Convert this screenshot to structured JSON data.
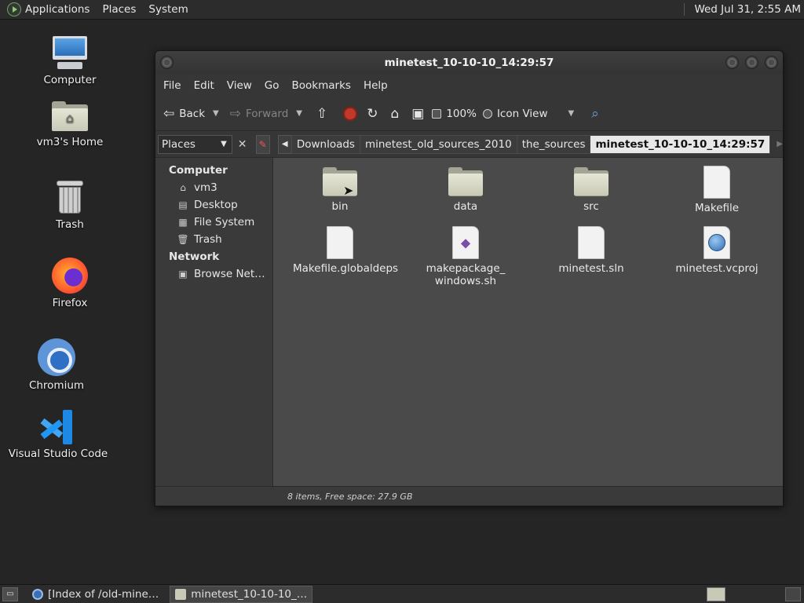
{
  "top_panel": {
    "menus": [
      "Applications",
      "Places",
      "System"
    ],
    "clock": "Wed Jul 31,  2:55 AM"
  },
  "desktop": {
    "icons": [
      {
        "label": "Computer",
        "icon": "computer-icon"
      },
      {
        "label": "vm3's Home",
        "icon": "home-folder-icon"
      },
      {
        "label": "Trash",
        "icon": "trash-icon"
      },
      {
        "label": "Firefox",
        "icon": "firefox-icon"
      },
      {
        "label": "Chromium",
        "icon": "chromium-icon"
      },
      {
        "label": "Visual Studio Code",
        "icon": "vscode-icon"
      }
    ]
  },
  "window": {
    "title": "minetest_10-10-10_14:29:57",
    "menubar": [
      "File",
      "Edit",
      "View",
      "Go",
      "Bookmarks",
      "Help"
    ],
    "toolbar": {
      "back_label": "Back",
      "forward_label": "Forward",
      "zoom": "100%",
      "view_mode": "Icon View"
    },
    "pathbar": {
      "places_label": "Places",
      "crumbs": [
        "Downloads",
        "minetest_old_sources_2010",
        "the_sources",
        "minetest_10-10-10_14:29:57"
      ]
    },
    "sidebar": {
      "sections": [
        {
          "title": "Computer",
          "items": [
            "vm3",
            "Desktop",
            "File System",
            "Trash"
          ]
        },
        {
          "title": "Network",
          "items": [
            "Browse Net…"
          ]
        }
      ]
    },
    "files": [
      {
        "name": "bin",
        "type": "folder"
      },
      {
        "name": "data",
        "type": "folder"
      },
      {
        "name": "src",
        "type": "folder"
      },
      {
        "name": "Makefile",
        "type": "document"
      },
      {
        "name": "Makefile.globaldeps",
        "type": "document"
      },
      {
        "name_line1": "makepackage_",
        "name_line2": "windows.sh",
        "type": "script"
      },
      {
        "name": "minetest.sln",
        "type": "document"
      },
      {
        "name": "minetest.vcproj",
        "type": "web-document"
      }
    ],
    "status": "8 items, Free space: 27.9 GB"
  },
  "taskbar": {
    "tasks": [
      "[Index of /old-mine…",
      "minetest_10-10-10_…"
    ]
  },
  "colors": {
    "panel": "#2c2c2c",
    "window_bg": "#3a3a3a",
    "content_bg": "#4a4a4a",
    "folder": "#c9c9b6",
    "active_crumb": "#e8e8e8",
    "stop_red": "#c0392b"
  }
}
